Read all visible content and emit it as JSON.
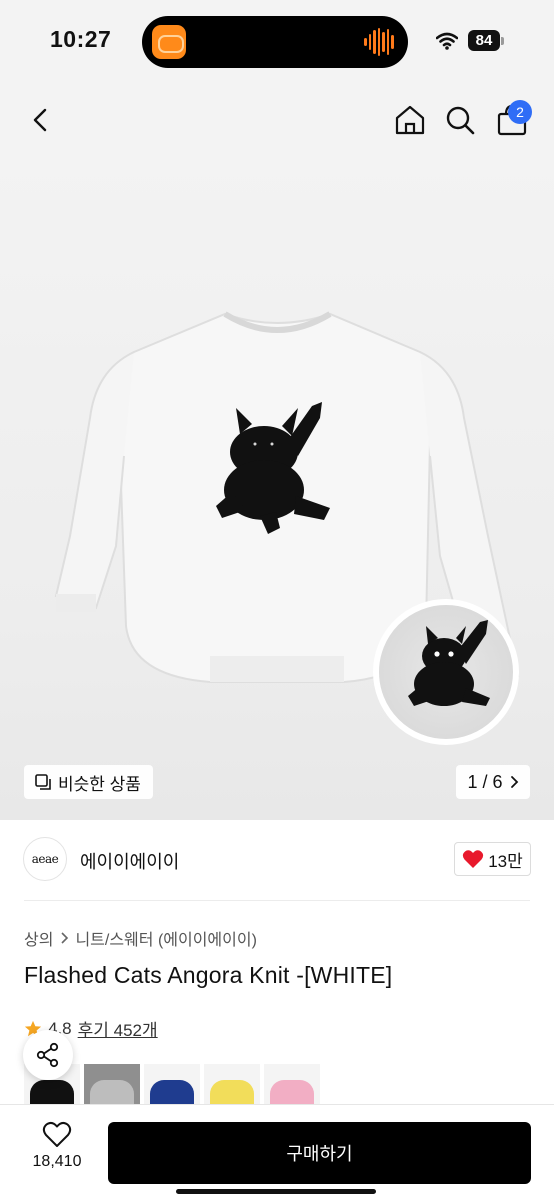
{
  "status_bar": {
    "time": "10:27",
    "battery": "84"
  },
  "header": {
    "cart_count": "2",
    "icons": [
      "back-icon",
      "home-icon",
      "search-icon",
      "shopping-bag-icon"
    ]
  },
  "image": {
    "similar_label": "비슷한 상품",
    "page": "1 / 6"
  },
  "brand": {
    "logo_text": "aeae",
    "name": "에이이에이이",
    "likes": "13만"
  },
  "breadcrumb": {
    "category": "상의",
    "subcategory": "니트/스웨터 (에이이에이이)"
  },
  "product": {
    "title": "Flashed Cats Angora Knit -[WHITE]",
    "rating": "4.8",
    "review_label": "후기 452개"
  },
  "swatch_colors": [
    "#111111",
    "#bdbdbd",
    "#1f3c8f",
    "#f2dd5a",
    "#f2aec4"
  ],
  "bottom": {
    "wish_count": "18,410",
    "buy_label": "구매하기"
  },
  "colors": {
    "accent": "#2f6df6",
    "heart": "#e8192c",
    "star": "#f5a623"
  }
}
